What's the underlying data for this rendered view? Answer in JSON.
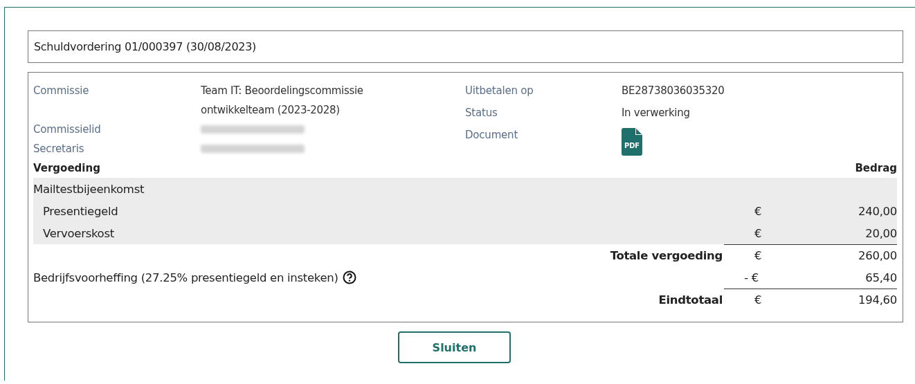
{
  "title": "Schuldvordering 01/000397 (30/08/2023)",
  "details_left": [
    {
      "label": "Commissie",
      "value": "Team IT: Beoordelingscommissie ontwikkelteam (2023-2028)",
      "blurred": false
    },
    {
      "label": "Commissielid",
      "blurred": true
    },
    {
      "label": "Secretaris",
      "blurred": true
    }
  ],
  "details_right": [
    {
      "label": "Uitbetalen op",
      "kind": "text",
      "value": "BE28738036035320"
    },
    {
      "label": "Status",
      "kind": "text",
      "value": "In verwerking"
    },
    {
      "label": "Document",
      "kind": "file",
      "value": "PDF"
    }
  ],
  "table": {
    "columns": [
      "Vergoeding",
      "Bedrag"
    ],
    "groups": [
      {
        "name": "Mailtestbijeenkomst",
        "items": [
          {
            "label": "Presentiegeld",
            "currency": "€",
            "amount": "240,00"
          },
          {
            "label": "Vervoerskost",
            "currency": "€",
            "amount": "20,00"
          }
        ]
      }
    ]
  },
  "totals": [
    {
      "kind": "subtotal",
      "label": "Totale vergoeding",
      "currency": "€",
      "amount": "260,00",
      "help": false
    },
    {
      "kind": "deduction",
      "label": "Bedrijfsvoorheffing (27.25% presentiegeld en insteken)",
      "currency": "- €",
      "amount": "65,40",
      "help": true
    },
    {
      "kind": "total",
      "label": "Eindtotaal",
      "currency": "€",
      "amount": "194,60",
      "help": false
    }
  ],
  "buttons": [
    "Sluiten"
  ]
}
